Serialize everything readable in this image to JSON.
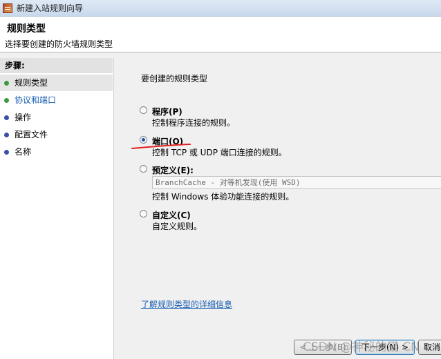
{
  "window": {
    "title": "新建入站规则向导",
    "icon": "firewall-wizard-icon"
  },
  "header": {
    "title": "规则类型",
    "subtitle": "选择要创建的防火墙规则类型"
  },
  "sidebar": {
    "label": "步骤:",
    "items": [
      {
        "label": "规则类型",
        "status": "green",
        "active": true
      },
      {
        "label": "协议和端口",
        "status": "green",
        "active": false
      },
      {
        "label": "操作",
        "status": "blue",
        "active": false
      },
      {
        "label": "配置文件",
        "status": "blue",
        "active": false
      },
      {
        "label": "名称",
        "status": "blue",
        "active": false
      }
    ]
  },
  "main": {
    "question": "要创建的规则类型",
    "options": [
      {
        "label": "程序(P)",
        "desc": "控制程序连接的规则。",
        "checked": false
      },
      {
        "label": "端口(O)",
        "desc": "控制 TCP 或 UDP 端口连接的规则。",
        "checked": true
      },
      {
        "label": "预定义(E):",
        "select_value": "BranchCache - 对等机发现(使用 WSD)",
        "desc": "控制 Windows 体验功能连接的规则。",
        "checked": false
      },
      {
        "label": "自定义(C)",
        "desc": "自定义规则。",
        "checked": false
      }
    ],
    "learn_more_link": "了解规则类型的详细信息"
  },
  "buttons": {
    "back": "< 上一步(B)",
    "next": "下一步(N) >",
    "cancel": "取消"
  },
  "watermark": "CSDN @神秘的猫 CN",
  "colors": {
    "link": "#1a5fb4",
    "annotation": "#e02020",
    "status_green": "#3d9a3d",
    "status_blue": "#3b4ea8"
  }
}
